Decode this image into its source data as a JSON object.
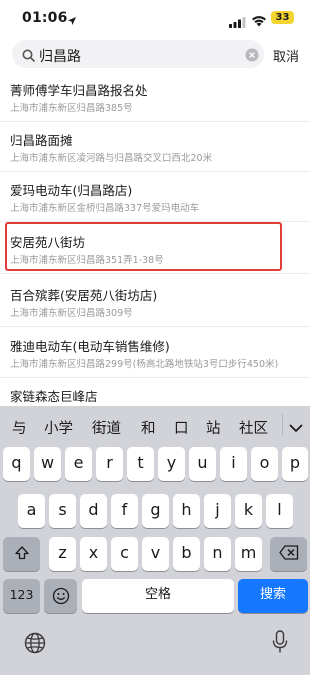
{
  "status_bar": {
    "time": "01:06",
    "battery": "33"
  },
  "search": {
    "query": "归昌路",
    "cancel_label": "取消"
  },
  "results": [
    {
      "title": "菁师傅学车归昌路报名处",
      "address": "上海市浦东新区归昌路385号"
    },
    {
      "title": "归昌路面摊",
      "address": "上海市浦东新区凌河路与归昌路交叉口西北20米"
    },
    {
      "title": "爱玛电动车(归昌路店)",
      "address": "上海市浦东新区金桥归昌路337号爱玛电动车"
    },
    {
      "title": "安居苑八街坊",
      "address": "上海市浦东新区归昌路351弄1-38号",
      "highlighted": true
    },
    {
      "title": "百合殡葬(安居苑八街坊店)",
      "address": "上海市浦东新区归昌路309号"
    },
    {
      "title": "雅迪电动车(电动车销售维修)",
      "address": "上海市浦东新区归昌路299号(杨高北路地铁站3号口步行450米)"
    },
    {
      "title": "家链森态巨峰店",
      "address": ""
    }
  ],
  "keyboard": {
    "candidates": [
      "与",
      "小学",
      "街道",
      "和",
      "口",
      "站",
      "社区"
    ],
    "row1": [
      "q",
      "w",
      "e",
      "r",
      "t",
      "y",
      "u",
      "i",
      "o",
      "p"
    ],
    "row2": [
      "a",
      "s",
      "d",
      "f",
      "g",
      "h",
      "j",
      "k",
      "l"
    ],
    "row3": [
      "z",
      "x",
      "c",
      "v",
      "b",
      "n",
      "m"
    ],
    "num_label": "123",
    "space_label": "空格",
    "search_label": "搜索"
  }
}
